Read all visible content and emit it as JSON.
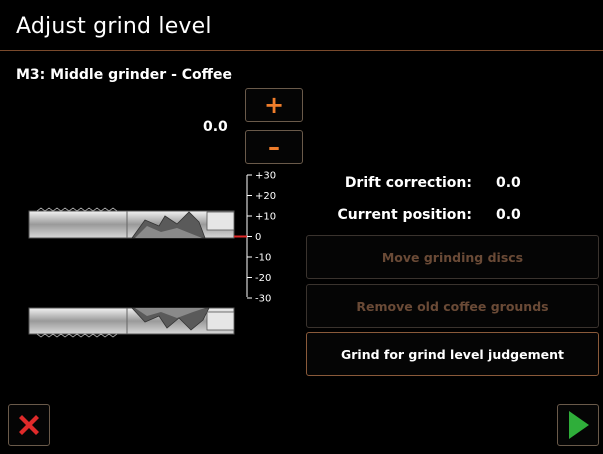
{
  "header": {
    "title": "Adjust grind level",
    "subtitle": "M3: Middle grinder - Coffee"
  },
  "grind": {
    "value": "0.0",
    "plus_label": "+",
    "minus_label": "–"
  },
  "scale": {
    "ticks": [
      "+30",
      "+20",
      "+10",
      "0",
      "-10",
      "-20",
      "-30"
    ],
    "current_level": 0
  },
  "info": {
    "drift_label": "Drift correction:",
    "drift_value": "0.0",
    "position_label": "Current position:",
    "position_value": "0.0"
  },
  "actions": {
    "move_discs": "Move grinding discs",
    "remove_grounds": "Remove old coffee grounds",
    "grind_judgement": "Grind for grind level judgement"
  },
  "colors": {
    "accent": "#ef7d2b",
    "cancel": "#e02a2a",
    "confirm": "#2fae3a",
    "rule": "#7a4a2c"
  },
  "icons": {
    "cancel": "close-x-icon",
    "next": "play-arrow-icon"
  }
}
